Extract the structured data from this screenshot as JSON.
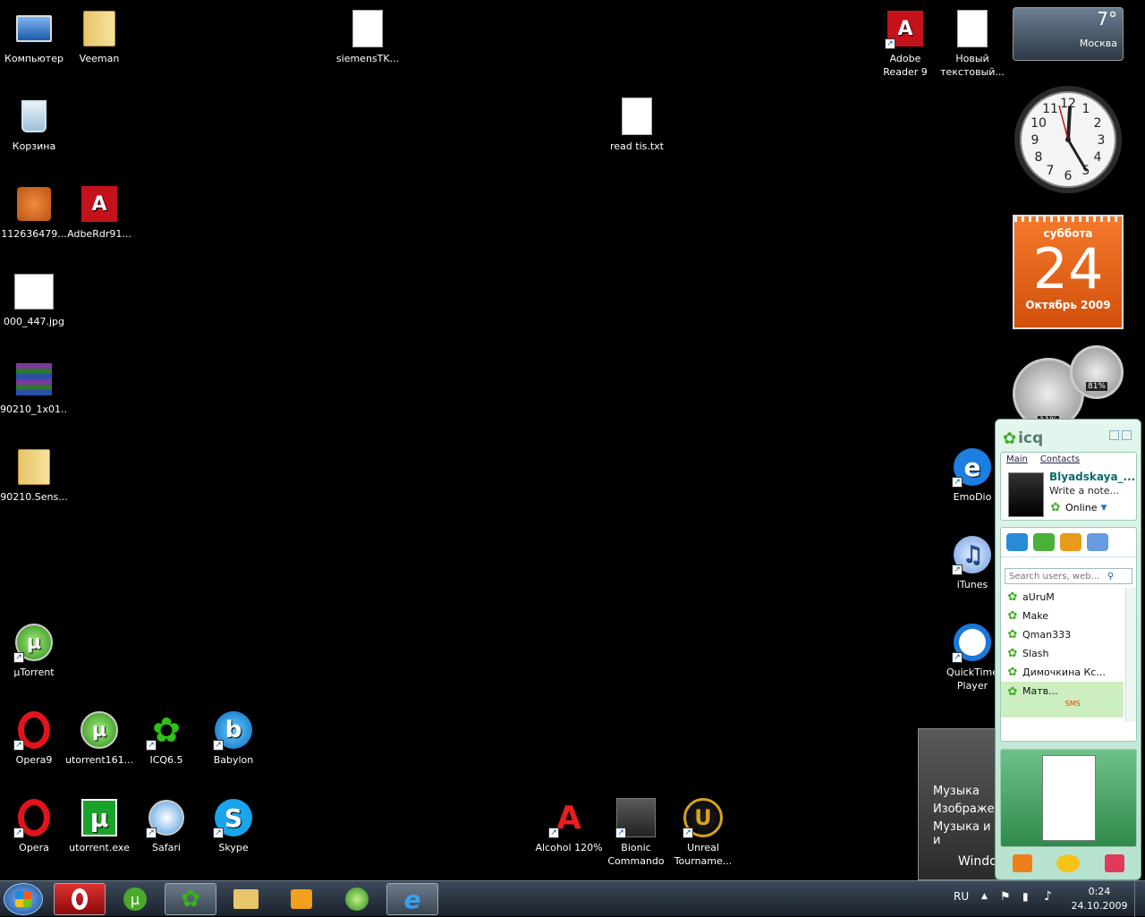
{
  "desktop": {
    "icons": [
      {
        "id": "computer",
        "label": "Компьютер",
        "icon": "computer-icon"
      },
      {
        "id": "veeman",
        "label": "Veeman",
        "icon": "user-folder-icon"
      },
      {
        "id": "siemens",
        "label": "siemensTK...",
        "icon": "pdf-document-icon"
      },
      {
        "id": "adobe-reader",
        "label": "Adobe Reader 9",
        "icon": "adobe-reader-icon"
      },
      {
        "id": "new-text",
        "label": "Новый текстовый...",
        "icon": "text-document-icon"
      },
      {
        "id": "recycle",
        "label": "Корзина",
        "icon": "recycle-bin-icon"
      },
      {
        "id": "read-tis",
        "label": "read tis.txt",
        "icon": "text-document-icon"
      },
      {
        "id": "leaf-image",
        "label": "112636479...",
        "icon": "image-icon"
      },
      {
        "id": "adberdr",
        "label": "AdbeRdr91...",
        "icon": "installer-icon"
      },
      {
        "id": "jpg",
        "label": "000_447.jpg",
        "icon": "image-icon"
      },
      {
        "id": "rar",
        "label": "90210_1x01...",
        "icon": "archive-icon"
      },
      {
        "id": "sens-folder",
        "label": "90210.Sens...",
        "icon": "folder-icon"
      },
      {
        "id": "utorrent-sc",
        "label": "µTorrent",
        "icon": "utorrent-icon"
      },
      {
        "id": "opera9",
        "label": "Opera9",
        "icon": "opera-icon"
      },
      {
        "id": "utorrent161",
        "label": "utorrent161...",
        "icon": "utorrent-icon"
      },
      {
        "id": "icq65",
        "label": "ICQ6.5",
        "icon": "icq-flower-icon"
      },
      {
        "id": "babylon",
        "label": "Babylon",
        "icon": "babylon-icon"
      },
      {
        "id": "opera",
        "label": "Opera",
        "icon": "opera-icon"
      },
      {
        "id": "utorrent-exe",
        "label": "utorrent.exe",
        "icon": "utorrent-exe-icon"
      },
      {
        "id": "safari",
        "label": "Safari",
        "icon": "safari-icon"
      },
      {
        "id": "skype",
        "label": "Skype",
        "icon": "skype-icon"
      },
      {
        "id": "alcohol",
        "label": "Alcohol 120%",
        "icon": "alcohol-icon"
      },
      {
        "id": "bionic",
        "label": "Bionic Commando",
        "icon": "game-icon"
      },
      {
        "id": "unreal",
        "label": "Unreal Tourname...",
        "icon": "unreal-icon"
      },
      {
        "id": "emodio",
        "label": "EmoDio",
        "icon": "emodio-icon"
      },
      {
        "id": "itunes",
        "label": "iTunes",
        "icon": "itunes-icon"
      },
      {
        "id": "quicktime",
        "label": "QuickTime Player",
        "icon": "quicktime-icon"
      }
    ]
  },
  "gadgets": {
    "weather": {
      "temp": "7°",
      "city": "Москва"
    },
    "calendar": {
      "weekday": "суббота",
      "day": "24",
      "month_year": "Октябрь 2009"
    },
    "meters": {
      "cpu": "11%",
      "mem": "81%"
    }
  },
  "icq": {
    "logo": "icq",
    "tabs": [
      "Main",
      "Contacts"
    ],
    "user": {
      "name": "Blyadskaya_...",
      "note": "Write a note...",
      "status": "Online"
    },
    "search_placeholder": "Search users, web...",
    "contacts": [
      "aUruM",
      "Make",
      "Qman333",
      "Slash",
      "Димочкина Кс...",
      "Матв..."
    ],
    "sms": "SMS"
  },
  "start_peek": {
    "items": [
      "Музыка",
      "Изображен",
      "Музыка и и"
    ],
    "footer": "Windo"
  },
  "taskbar": {
    "lang": "RU",
    "time": "0:24",
    "date": "24.10.2009"
  },
  "colors": {
    "accent_icq": "#3ab01f",
    "calendar": "#e8621c",
    "taskbar": "#1a212b"
  }
}
